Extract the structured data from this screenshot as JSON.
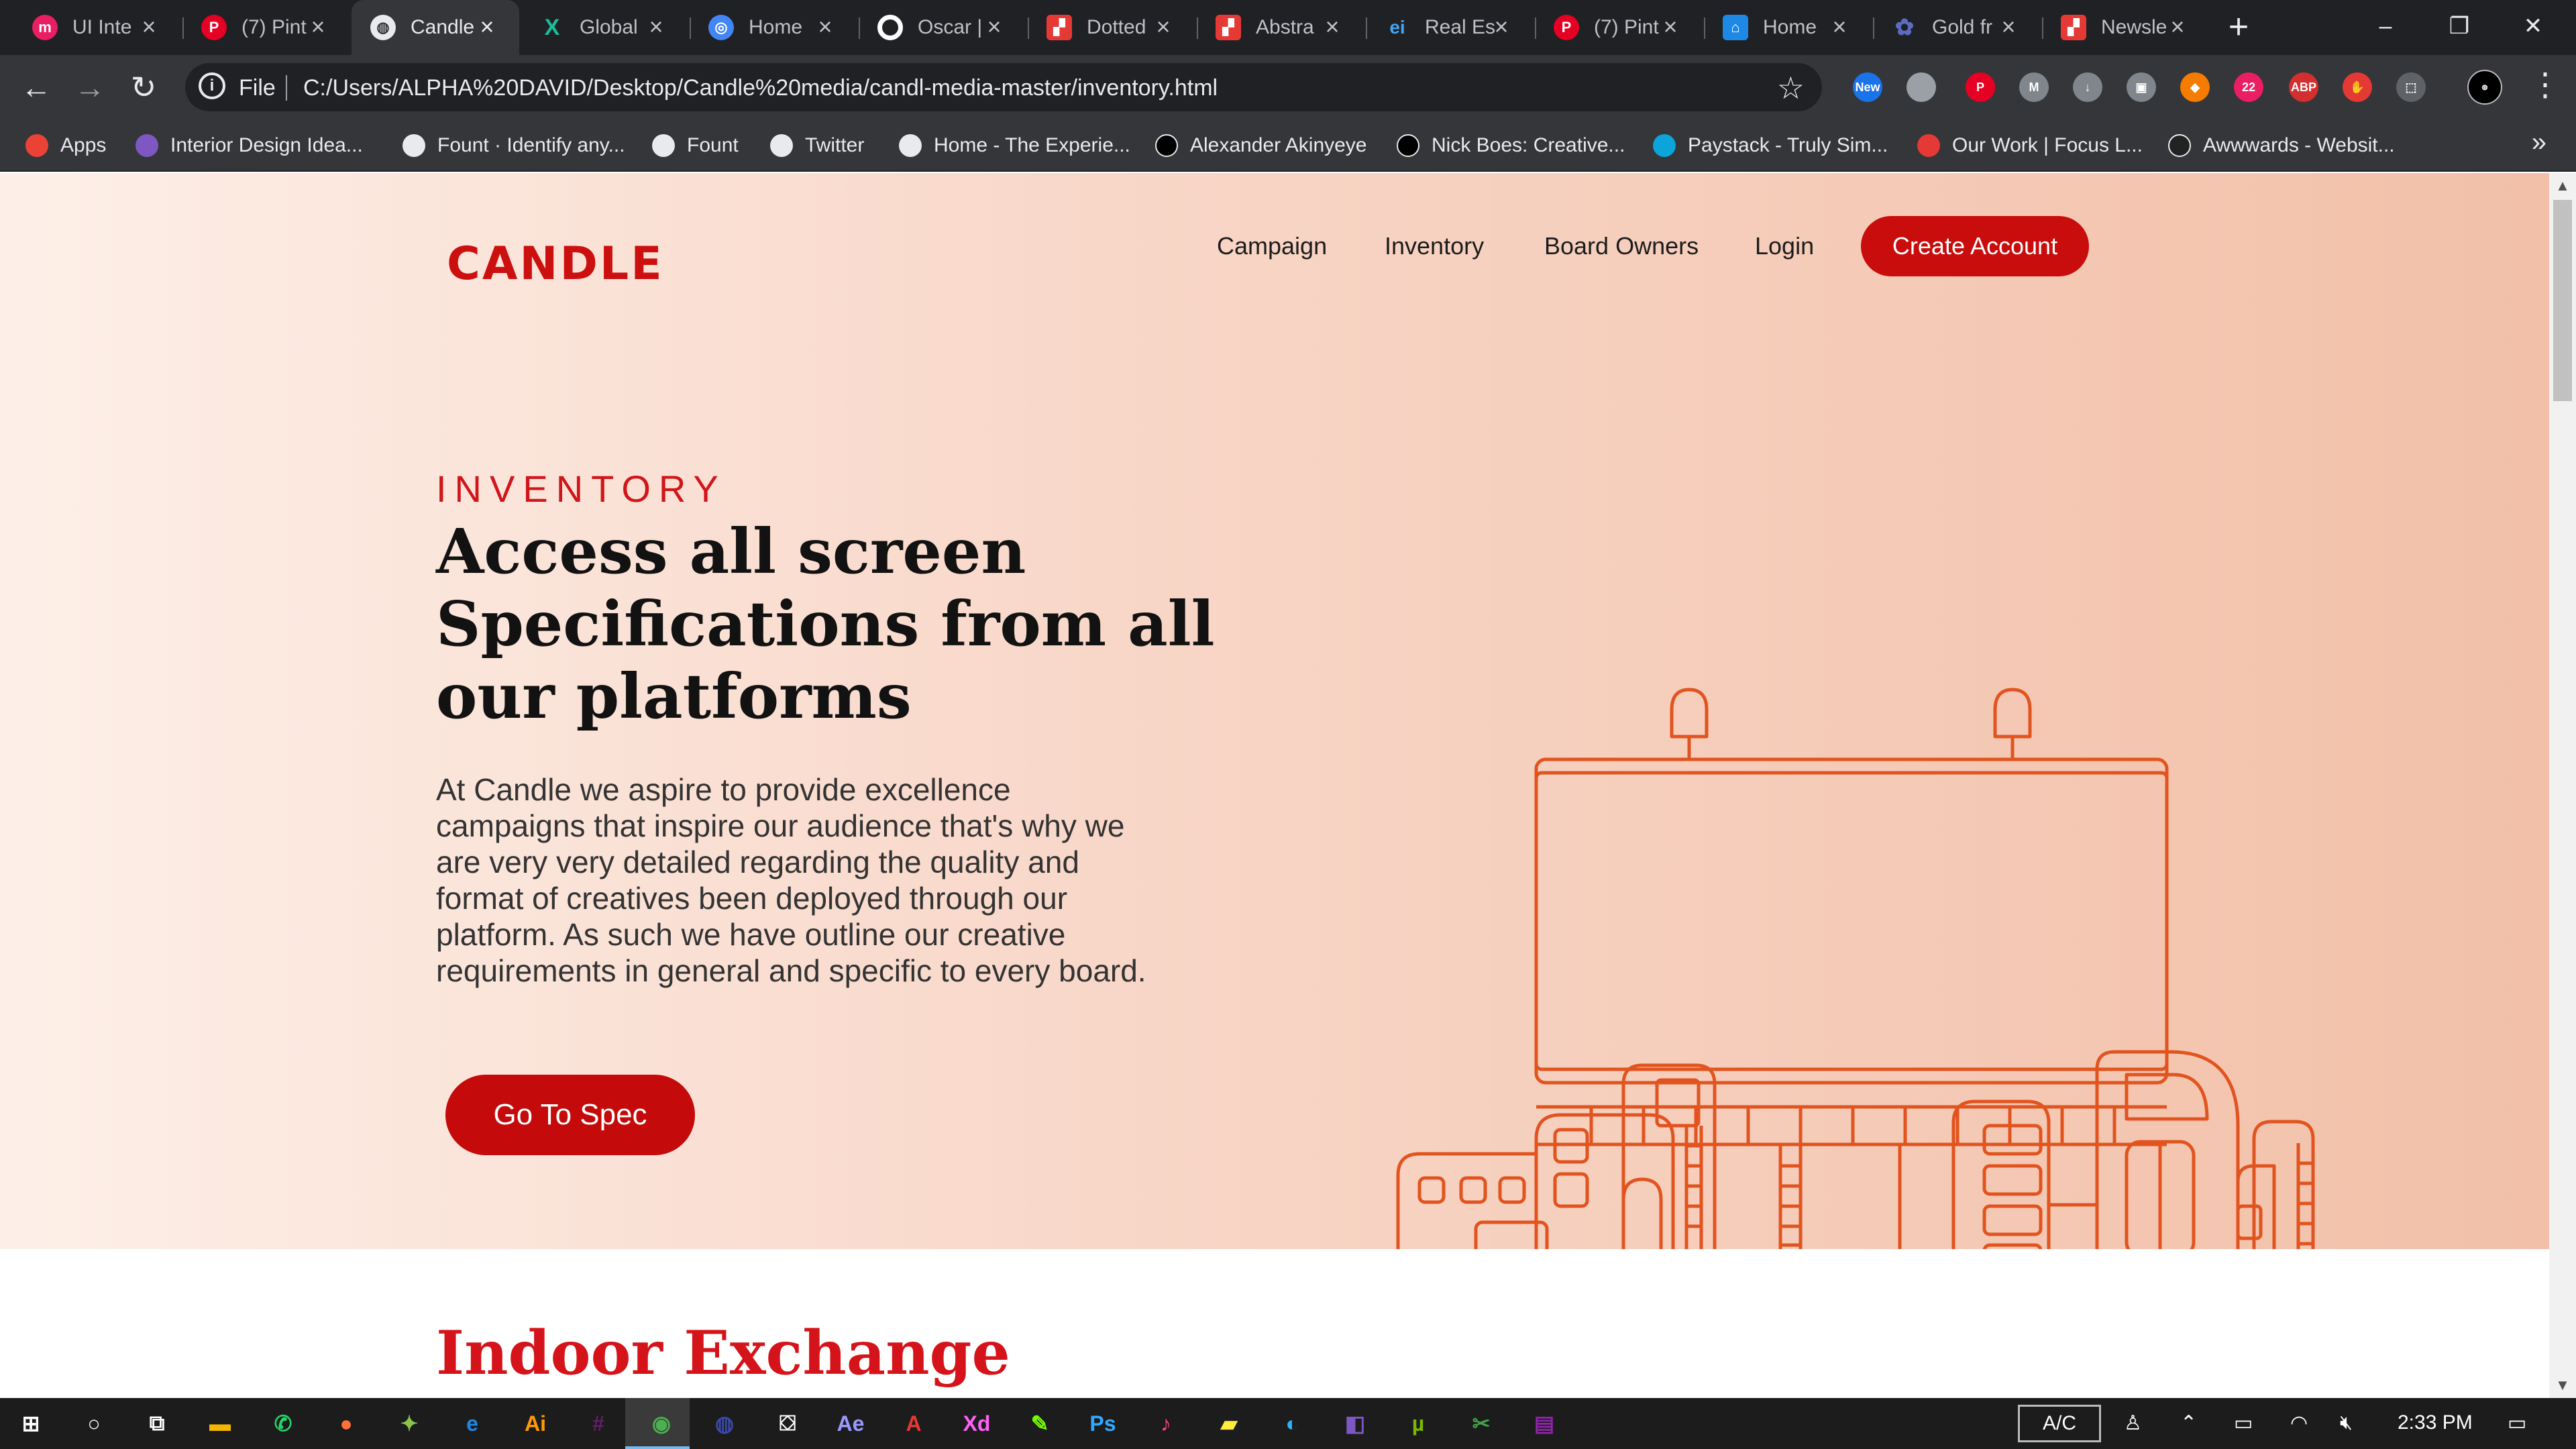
{
  "browser": {
    "tabs": [
      {
        "title": "UI Inte",
        "icon": "m-logo-icon",
        "color": "#e91e63"
      },
      {
        "title": "(7) Pint",
        "icon": "pinterest-icon",
        "color": "#e60023"
      },
      {
        "title": "Candle",
        "icon": "globe-icon",
        "color": "#e8eaed"
      },
      {
        "title": "Global",
        "icon": "x-logo-icon",
        "color": "#1abc9c"
      },
      {
        "title": "Home",
        "icon": "circle-logo-icon",
        "color": "#4285f4"
      },
      {
        "title": "Oscar |",
        "icon": "ring-icon",
        "color": "#ffffff"
      },
      {
        "title": "Dotted",
        "icon": "red-square-icon",
        "color": "#e53935"
      },
      {
        "title": "Abstra",
        "icon": "red-square-icon",
        "color": "#e53935"
      },
      {
        "title": "Real Es",
        "icon": "ei-logo-icon",
        "color": "#1976d2"
      },
      {
        "title": "(7) Pint",
        "icon": "pinterest-icon",
        "color": "#e60023"
      },
      {
        "title": "Home",
        "icon": "bell-icon",
        "color": "#1e88e5"
      },
      {
        "title": "Gold fr",
        "icon": "gear-logo-icon",
        "color": "#3f51b5"
      },
      {
        "title": "Newsle",
        "icon": "red-square-icon",
        "color": "#e53935"
      }
    ],
    "new_tab_symbol": "+",
    "window_controls": {
      "minimize": "–",
      "restore": "❐",
      "close": "✕"
    },
    "nav": {
      "back": "←",
      "forward": "→",
      "reload": "↻"
    },
    "address": {
      "scheme_label": "File",
      "url": "C:/Users/ALPHA%20DAVID/Desktop/Candle%20media/candl-media-master/inventory.html",
      "star": "☆"
    },
    "extensions": [
      {
        "name": "new-extension-icon",
        "label": "New",
        "color": "#1a73e8"
      },
      {
        "name": "pocket-icon",
        "label": "",
        "color": "#9aa0a6"
      },
      {
        "name": "pinterest-ext-icon",
        "label": "P",
        "color": "#e60023"
      },
      {
        "name": "m-ext-icon",
        "label": "M",
        "color": "#80868b"
      },
      {
        "name": "download-ext-icon",
        "label": "↓",
        "color": "#80868b"
      },
      {
        "name": "image-ext-icon",
        "label": "▣",
        "color": "#80868b"
      },
      {
        "name": "tag-ext-icon",
        "label": "◆",
        "color": "#f57c00"
      },
      {
        "name": "badge-ext-icon",
        "label": "22",
        "color": "#e91e63"
      },
      {
        "name": "adblock-icon",
        "label": "ABP",
        "color": "#d32f2f"
      },
      {
        "name": "stop-hand-icon",
        "label": "✋",
        "color": "#e53935"
      },
      {
        "name": "pdf-ext-icon",
        "label": "⬚",
        "color": "#5f6368"
      }
    ],
    "menu_symbol": "⋮",
    "bookmarks": [
      {
        "label": "Apps",
        "icon": "apps-grid-icon",
        "color": "#ea4335"
      },
      {
        "label": "Interior Design Idea...",
        "icon": "cube-icon",
        "color": "#7e57c2"
      },
      {
        "label": "Fount · Identify any...",
        "icon": "globe-icon",
        "color": "#e8eaed"
      },
      {
        "label": "Fount",
        "icon": "globe-icon",
        "color": "#e8eaed"
      },
      {
        "label": "Twitter",
        "icon": "globe-icon",
        "color": "#e8eaed"
      },
      {
        "label": "Home - The Experie...",
        "icon": "globe-icon",
        "color": "#e8eaed"
      },
      {
        "label": "Alexander Akinyeye",
        "icon": "mountain-icon",
        "color": "#000000"
      },
      {
        "label": "Nick Boes: Creative...",
        "icon": "n-logo-icon",
        "color": "#000000"
      },
      {
        "label": "Paystack - Truly Sim...",
        "icon": "paystack-icon",
        "color": "#0ba4db"
      },
      {
        "label": "Our Work | Focus L...",
        "icon": "focus-logo-icon",
        "color": "#e53935"
      },
      {
        "label": "Awwwards - Websit...",
        "icon": "w-logo-icon",
        "color": "#222222"
      }
    ],
    "bookmarks_more": "»"
  },
  "page": {
    "logo": "CANDLE",
    "nav": [
      "Campaign",
      "Inventory",
      "Board Owners",
      "Login"
    ],
    "cta": "Create Account",
    "hero": {
      "eyebrow": "INVENTORY",
      "headline": "Access all screen Specifications from all our platforms",
      "body": "At Candle we aspire to provide excellence campaigns that inspire our audience that's why we are very very detailed regarding the quality and format of creatives been deployed through our platform. As such we have outline our creative requirements in general and specific to every board.",
      "button": "Go To Spec"
    },
    "next_section_title": "Indoor Exchange",
    "colors": {
      "brand_red": "#c90c0c",
      "accent_orange": "#e2541f",
      "hero_bg_start": "#fdefe8",
      "hero_bg_end": "#f2c0a8"
    }
  },
  "taskbar": {
    "apps": [
      {
        "name": "start-icon",
        "label": "⊞",
        "color": "#ffffff"
      },
      {
        "name": "search-circle-icon",
        "label": "○",
        "color": "#ffffff"
      },
      {
        "name": "task-view-icon",
        "label": "⧉",
        "color": "#ffffff"
      },
      {
        "name": "file-explorer-icon",
        "label": "▬",
        "color": "#f4b400"
      },
      {
        "name": "whatsapp-icon",
        "label": "✆",
        "color": "#25d366"
      },
      {
        "name": "firefox-icon",
        "label": "●",
        "color": "#ff7139"
      },
      {
        "name": "puzzle-app-icon",
        "label": "✦",
        "color": "#8bc34a"
      },
      {
        "name": "edge-icon",
        "label": "e",
        "color": "#1e88e5"
      },
      {
        "name": "illustrator-icon",
        "label": "Ai",
        "color": "#ff9a00"
      },
      {
        "name": "slack-icon",
        "label": "#",
        "color": "#611f69"
      },
      {
        "name": "chrome-icon",
        "label": "◉",
        "color": "#4caf50"
      },
      {
        "name": "obs-icon",
        "label": "◍",
        "color": "#3949ab"
      },
      {
        "name": "store-icon",
        "label": "⛋",
        "color": "#ffffff"
      },
      {
        "name": "after-effects-icon",
        "label": "Ae",
        "color": "#9999ff"
      },
      {
        "name": "acrobat-icon",
        "label": "A",
        "color": "#e53935"
      },
      {
        "name": "xd-icon",
        "label": "Xd",
        "color": "#ff61f6"
      },
      {
        "name": "vector-app-icon",
        "label": "✎",
        "color": "#76ff03"
      },
      {
        "name": "photoshop-icon",
        "label": "Ps",
        "color": "#31a8ff"
      },
      {
        "name": "music-icon",
        "label": "♪",
        "color": "#ff4081"
      },
      {
        "name": "sticky-notes-icon",
        "label": "▰",
        "color": "#ffeb3b"
      },
      {
        "name": "paint-icon",
        "label": "◐",
        "color": "#29b6f6"
      },
      {
        "name": "visual-studio-icon",
        "label": "◧",
        "color": "#7e57c2"
      },
      {
        "name": "utorrent-icon",
        "label": "µ",
        "color": "#76b900"
      },
      {
        "name": "snip-icon",
        "label": "✂",
        "color": "#43a047"
      },
      {
        "name": "winrar-icon",
        "label": "▤",
        "color": "#8e24aa"
      }
    ],
    "ac_label": "A/C",
    "tray": {
      "people": "♙",
      "chevron": "⌃",
      "battery": "▭",
      "wifi": "◠",
      "volume": "🔇︎",
      "time": "2:33 PM",
      "notifications": "▭"
    }
  },
  "scrollbar": {
    "up": "▲",
    "down": "▼"
  }
}
